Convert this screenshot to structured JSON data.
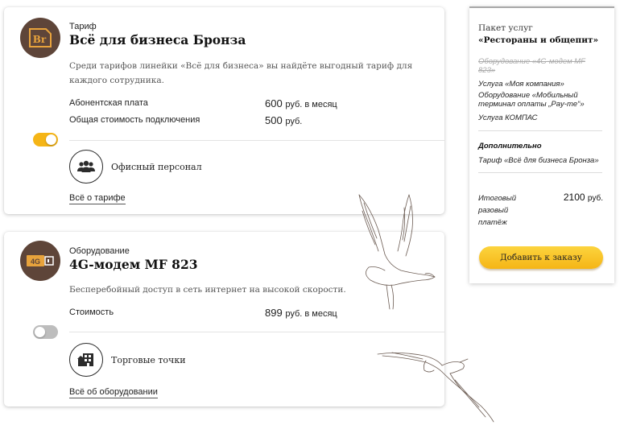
{
  "tariff_card": {
    "kind_label": "Тариф",
    "title": "Всё для бизнеса Бронза",
    "badge_text": "Br",
    "description": "Среди тарифов линейки «Всё для бизнеса» вы найдёте выгодный тариф для каждого сотрудника.",
    "rows": [
      {
        "label": "Абонентская плата",
        "value": "600",
        "unit": "руб. в месяц"
      },
      {
        "label": "Общая стоимость подключения",
        "value": "500",
        "unit": "руб."
      }
    ],
    "toggle_on": true,
    "feature": {
      "icon": "people-group-icon",
      "text": "Офисный персонал"
    },
    "more_link": "Всё о тарифе"
  },
  "equipment_card": {
    "kind_label": "Оборудование",
    "title": "4G-модем MF 823",
    "badge_text": "4G",
    "description": "Бесперебойный доступ в сеть интернет на высокой скорости.",
    "rows": [
      {
        "label": "Стоимость",
        "value": "899",
        "unit": "руб. в месяц"
      }
    ],
    "toggle_on": false,
    "feature": {
      "icon": "store-building-icon",
      "text": "Торговые точки"
    },
    "more_link": "Всё об оборудовании"
  },
  "summary": {
    "label": "Пакет услуг",
    "title": "«Рестораны и общепит»",
    "removed_item": "Оборудование «4G-модем MF 823»",
    "items": [
      "Услуга «Моя компания»",
      "Оборудование «Мобильный терминал оплаты „Pay-me“»",
      "Услуга КОМПАС"
    ],
    "additional_heading": "Дополнительно",
    "additional_item": "Тариф «Всё для бизнеса Бронза»",
    "total_label": "Итоговый разовый платёж",
    "total_value": "2100",
    "total_unit": "руб.",
    "order_button": "Добавить к заказу"
  },
  "colors": {
    "accent_yellow": "#f5b516",
    "icon_brown": "#5e4539",
    "badge_orange": "#e8a33c"
  }
}
